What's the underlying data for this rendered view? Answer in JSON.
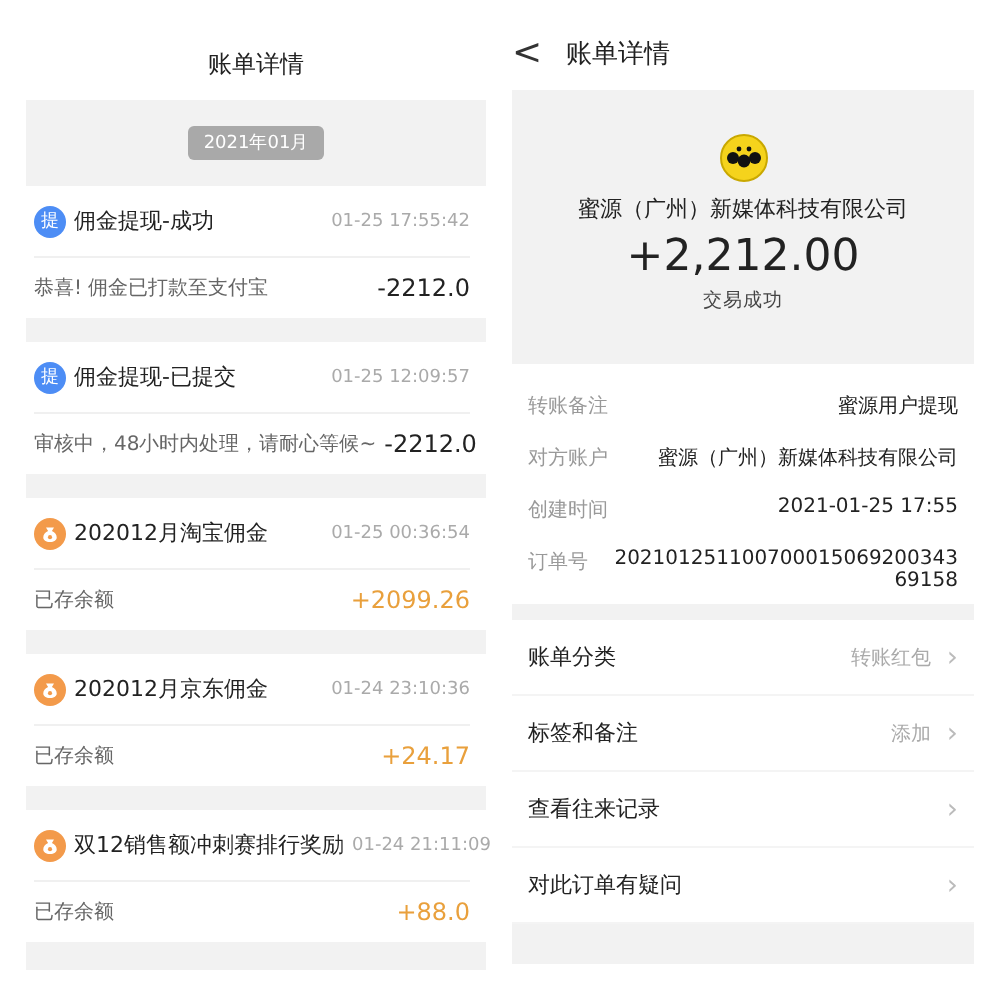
{
  "list_screen": {
    "title": "账单详情",
    "month": "2021年01月",
    "items": [
      {
        "kind": "withdraw",
        "icon_label": "提",
        "title": "佣金提现-成功",
        "time": "01-25 17:55:42",
        "note": "恭喜! 佣金已打款至支付宝",
        "amount": "-2212.0"
      },
      {
        "kind": "withdraw",
        "icon_label": "提",
        "title": "佣金提现-已提交",
        "time": "01-25 12:09:57",
        "note": "审核中，48小时内处理，请耐心等候~",
        "amount": "-2212.0"
      },
      {
        "kind": "income",
        "title": "202012月淘宝佣金",
        "time": "01-25 00:36:54",
        "note": "已存余额",
        "amount": "+2099.26"
      },
      {
        "kind": "income",
        "title": "202012月京东佣金",
        "time": "01-24 23:10:36",
        "note": "已存余额",
        "amount": "+24.17"
      },
      {
        "kind": "income",
        "title": "双12销售额冲刺赛排行奖励",
        "time": "01-24 21:11:09",
        "note": "已存余额",
        "amount": "+88.0"
      }
    ]
  },
  "detail_screen": {
    "back": "<",
    "title": "账单详情",
    "payer": "蜜源（广州）新媒体科技有限公司",
    "amount": "+2,212.00",
    "status": "交易成功",
    "fields": [
      {
        "label": "转账备注",
        "value": "蜜源用户提现"
      },
      {
        "label": "对方账户",
        "value": "蜜源（广州）新媒体科技有限公司"
      },
      {
        "label": "创建时间",
        "value": "2021-01-25 17:55"
      },
      {
        "label": "订单号",
        "value": "20210125110070001506920034369158"
      }
    ],
    "menu": [
      {
        "label": "账单分类",
        "value": "转账红包",
        "chevron": "›"
      },
      {
        "label": "标签和备注",
        "value": "添加",
        "chevron": "›"
      },
      {
        "label": "查看往来记录",
        "chevron": "›"
      },
      {
        "label": "对此订单有疑问",
        "chevron": "›"
      }
    ]
  }
}
